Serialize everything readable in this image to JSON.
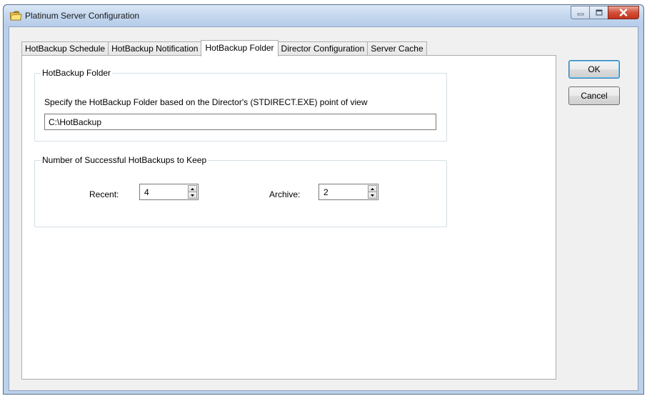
{
  "window": {
    "title": "Platinum Server Configuration",
    "icon": "folder-icon"
  },
  "caption_buttons": [
    "minimize",
    "maximize",
    "close"
  ],
  "tabs": [
    {
      "label": "HotBackup Schedule",
      "active": false
    },
    {
      "label": "HotBackup Notification",
      "active": false
    },
    {
      "label": "HotBackup Folder",
      "active": true
    },
    {
      "label": "Director Configuration",
      "active": false
    },
    {
      "label": "Server Cache",
      "active": false
    }
  ],
  "folder_group": {
    "legend": "HotBackup Folder",
    "description": "Specify the HotBackup Folder based on the Director's (STDIRECT.EXE) point of view",
    "path_value": "C:\\HotBackup"
  },
  "keep_group": {
    "legend": "Number of Successful HotBackups to Keep",
    "recent_label": "Recent:",
    "recent_value": "4",
    "archive_label": "Archive:",
    "archive_value": "2"
  },
  "buttons": {
    "ok": "OK",
    "cancel": "Cancel"
  },
  "colors": {
    "titlebar": "#c4d7ee",
    "close_button": "#d4513a",
    "dialog_background": "#f0f0f0",
    "default_button_border": "#3c7fb1"
  }
}
